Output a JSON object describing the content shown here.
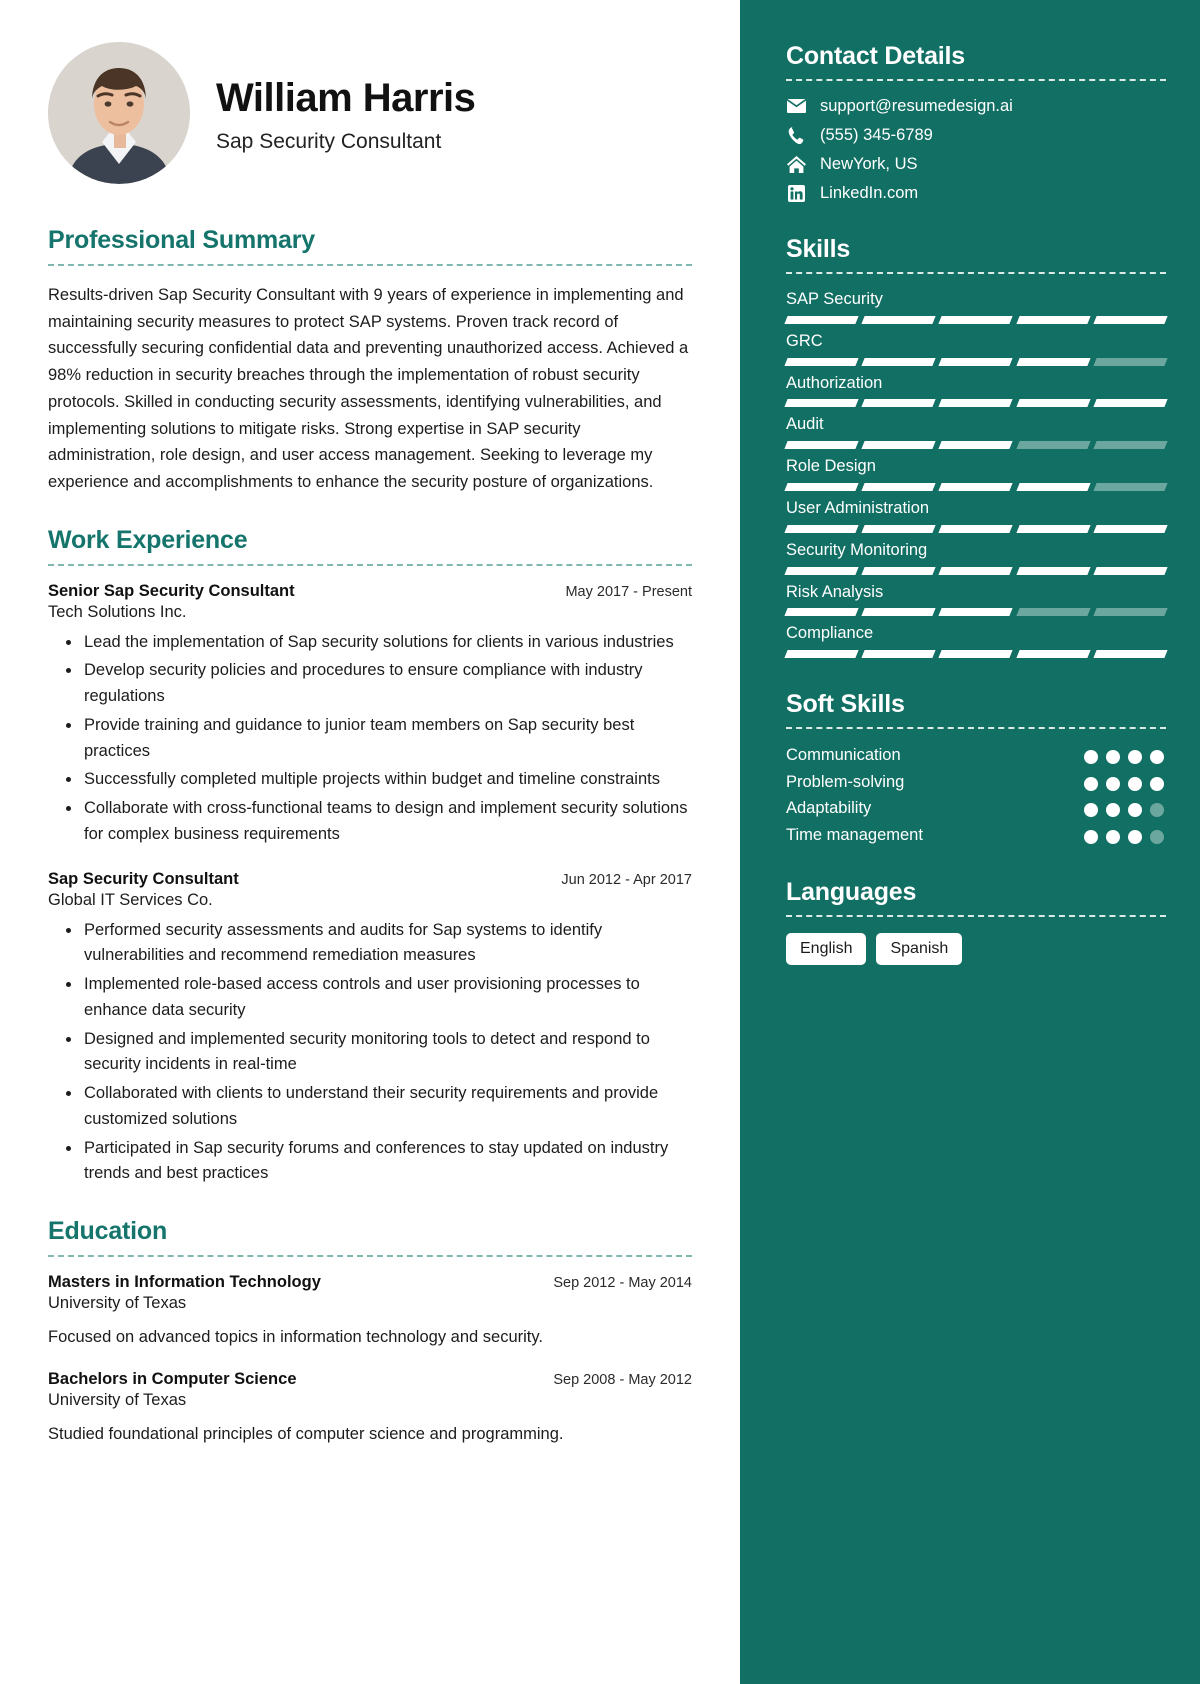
{
  "header": {
    "name": "William Harris",
    "title": "Sap Security Consultant",
    "avatar_icon": "portrait-photo"
  },
  "accent_color": "#15746b",
  "sidebar_color": "#126f64",
  "sections": {
    "summary_title": "Professional Summary",
    "experience_title": "Work Experience",
    "education_title": "Education"
  },
  "summary": {
    "text": "Results-driven Sap Security Consultant with 9 years of experience in implementing and maintaining security measures to protect SAP systems. Proven track record of successfully securing confidential data and preventing unauthorized access. Achieved a 98% reduction in security breaches through the implementation of robust security protocols. Skilled in conducting security assessments, identifying vulnerabilities, and implementing solutions to mitigate risks. Strong expertise in SAP security administration, role design, and user access management. Seeking to leverage my experience and accomplishments to enhance the security posture of organizations."
  },
  "experience": [
    {
      "role": "Senior Sap Security Consultant",
      "date": "May 2017 - Present",
      "company": "Tech Solutions Inc.",
      "bullets": [
        "Lead the implementation of Sap security solutions for clients in various industries",
        "Develop security policies and procedures to ensure compliance with industry regulations",
        "Provide training and guidance to junior team members on Sap security best practices",
        "Successfully completed multiple projects within budget and timeline constraints",
        "Collaborate with cross-functional teams to design and implement security solutions for complex business requirements"
      ]
    },
    {
      "role": "Sap Security Consultant",
      "date": "Jun 2012 - Apr 2017",
      "company": "Global IT Services Co.",
      "bullets": [
        "Performed security assessments and audits for Sap systems to identify vulnerabilities and recommend remediation measures",
        "Implemented role-based access controls and user provisioning processes to enhance data security",
        "Designed and implemented security monitoring tools to detect and respond to security incidents in real-time",
        "Collaborated with clients to understand their security requirements and provide customized solutions",
        "Participated in Sap security forums and conferences to stay updated on industry trends and best practices"
      ]
    }
  ],
  "education": [
    {
      "degree": "Masters in Information Technology",
      "date": "Sep 2012 - May 2014",
      "school": "University of Texas",
      "description": "Focused on advanced topics in information technology and security."
    },
    {
      "degree": "Bachelors in Computer Science",
      "date": "Sep 2008 - May 2012",
      "school": "University of Texas",
      "description": "Studied foundational principles of computer science and programming."
    }
  ],
  "contact": {
    "title": "Contact Details",
    "items": [
      {
        "icon": "envelope-icon",
        "value": "support@resumedesign.ai"
      },
      {
        "icon": "phone-icon",
        "value": "(555) 345-6789"
      },
      {
        "icon": "home-icon",
        "value": "NewYork, US"
      },
      {
        "icon": "linkedin-icon",
        "value": "LinkedIn.com"
      }
    ]
  },
  "skills": {
    "title": "Skills",
    "max_segments": 5,
    "items": [
      {
        "name": "SAP Security",
        "level": 5
      },
      {
        "name": "GRC",
        "level": 4
      },
      {
        "name": "Authorization",
        "level": 5
      },
      {
        "name": "Audit",
        "level": 3
      },
      {
        "name": "Role Design",
        "level": 4
      },
      {
        "name": "User Administration",
        "level": 5
      },
      {
        "name": "Security Monitoring",
        "level": 5
      },
      {
        "name": "Risk Analysis",
        "level": 3
      },
      {
        "name": "Compliance",
        "level": 5
      }
    ]
  },
  "soft_skills": {
    "title": "Soft Skills",
    "max_dots": 4,
    "items": [
      {
        "name": "Communication",
        "level": 4
      },
      {
        "name": "Problem-solving",
        "level": 4
      },
      {
        "name": "Adaptability",
        "level": 3
      },
      {
        "name": "Time management",
        "level": 3
      }
    ]
  },
  "languages": {
    "title": "Languages",
    "items": [
      "English",
      "Spanish"
    ]
  }
}
